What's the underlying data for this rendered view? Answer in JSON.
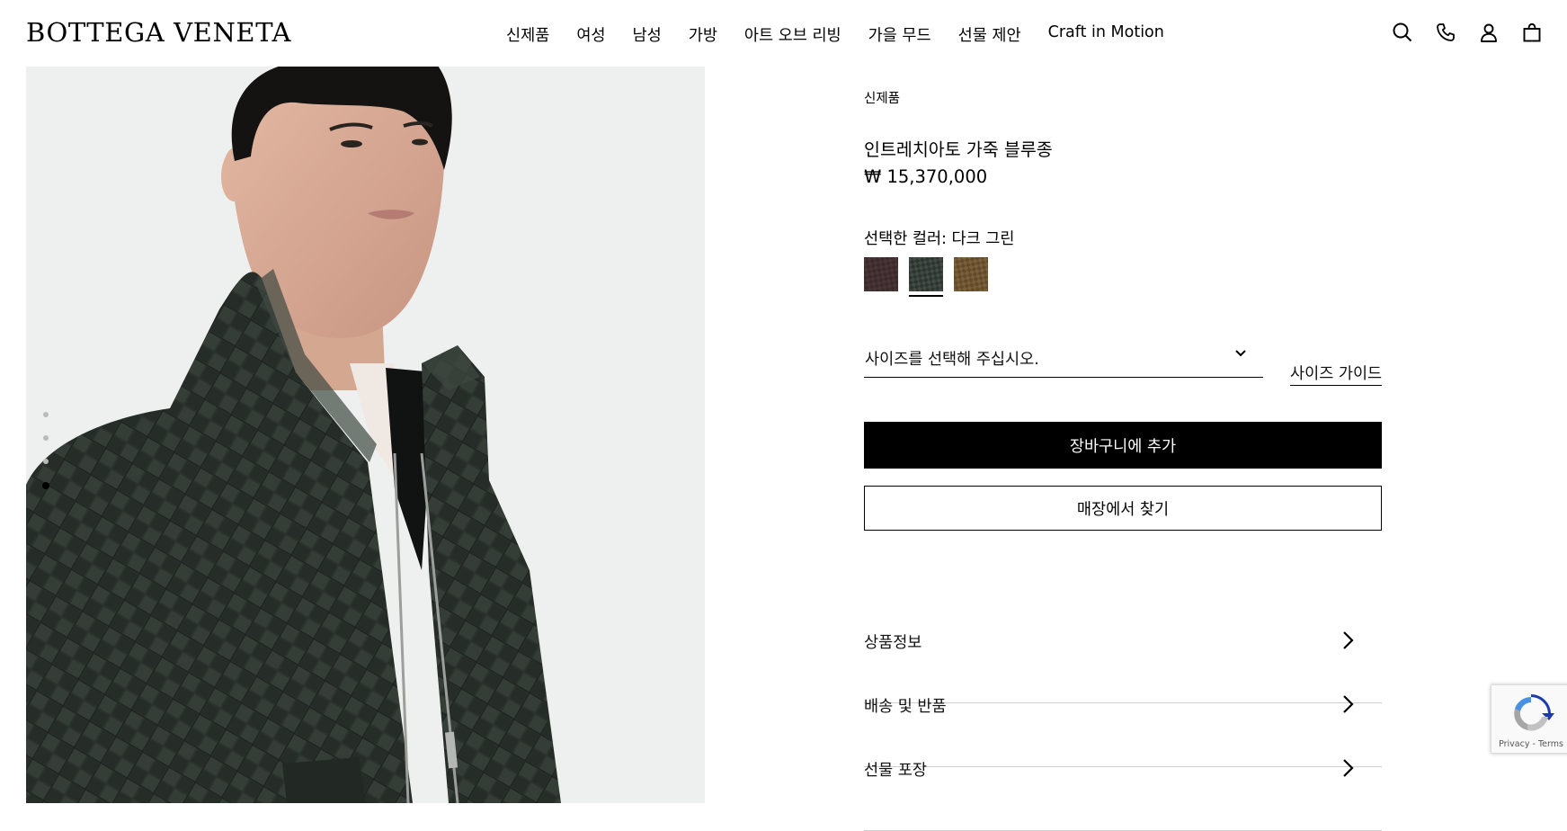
{
  "header": {
    "logo": "BOTTEGA VENETA",
    "nav": [
      "신제품",
      "여성",
      "남성",
      "가방",
      "아트 오브 리빙",
      "가을 무드",
      "선물 제안",
      "Craft in Motion"
    ],
    "icons": [
      "search-icon",
      "phone-icon",
      "account-icon",
      "shopping-bag-icon"
    ]
  },
  "gallery": {
    "dots_count": 4,
    "active_dot": 4
  },
  "product": {
    "breadcrumb": "신제품",
    "title": "인트레치아토 가죽 블루종",
    "price": "₩ 15,370,000",
    "color_label": "선택한 컬러: 다크 그린",
    "swatches": [
      {
        "name": "dark-brown",
        "color": "#3a2a2b",
        "selected": false
      },
      {
        "name": "dark-green",
        "color": "#333a35",
        "selected": true
      },
      {
        "name": "tan-brown",
        "color": "#6b5230",
        "selected": false
      }
    ],
    "size_placeholder": "사이즈를 선택해 주십시오.",
    "size_guide": "사이즈 가이드",
    "add_to_cart": "장바구니에 추가",
    "find_in_store": "매장에서 찾기",
    "accordion": [
      "상품정보",
      "배송 및 반품",
      "선물 포장"
    ]
  },
  "recaptcha": {
    "text": "Privacy - Terms"
  },
  "colors": {
    "background": "#ffffff",
    "primary": "#000000",
    "image_bg": "#eef0ef",
    "jacket": "#2c332d"
  }
}
